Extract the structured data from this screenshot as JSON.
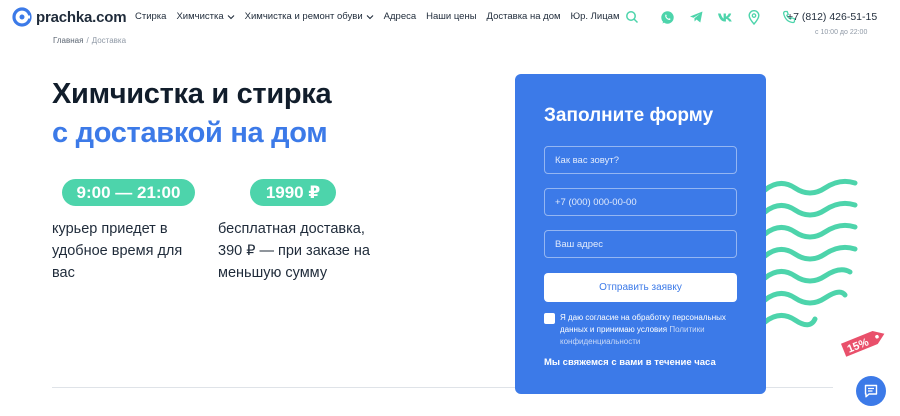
{
  "brand": {
    "name": "prachka.com",
    "accent": "#3c7ae8",
    "green": "#4dd4ab",
    "tag_color": "#e9506b"
  },
  "nav": {
    "items": [
      {
        "label": "Стирка",
        "dropdown": false
      },
      {
        "label": "Химчистка",
        "dropdown": true
      },
      {
        "label": "Химчистка и ремонт обуви",
        "dropdown": true
      },
      {
        "label": "Адреса",
        "dropdown": false
      },
      {
        "label": "Наши цены",
        "dropdown": false
      },
      {
        "label": "Доставка на дом",
        "dropdown": false
      },
      {
        "label": "Юр. Лицам",
        "dropdown": false
      }
    ]
  },
  "header_icons": [
    "search-icon",
    "whatsapp-icon",
    "telegram-icon",
    "vk-icon",
    "location-pin-icon",
    "phone-icon"
  ],
  "contact": {
    "phone": "+7 (812) 426-51-15",
    "hours": "с 10:00 до 22:00"
  },
  "breadcrumb": {
    "home": "Главная",
    "separator": "/",
    "current": "Доставка"
  },
  "hero": {
    "title_line1": "Химчистка и стирка",
    "title_line2": "с доставкой на дом",
    "feature1": {
      "badge": "9:00 — 21:00",
      "text": "курьер приедет в удобное время для вас"
    },
    "feature2": {
      "badge": "1990 ₽",
      "text": "бесплатная доставка, 390 ₽ — при заказе на меньшую сумму"
    }
  },
  "form": {
    "title": "Заполните форму",
    "name_placeholder": "Как вас зовут?",
    "phone_placeholder": "+7 (000) 000-00-00",
    "address_placeholder": "Ваш адрес",
    "submit_label": "Отправить заявку",
    "consent_text": "Я даю согласие на обработку персональных данных и принимаю условия",
    "consent_link": "Политики конфиденциальности",
    "callback_note": "Мы свяжемся с вами в течение часа"
  },
  "discount_tag": {
    "label": "15%"
  },
  "chat": {
    "icon": "chat-icon"
  }
}
